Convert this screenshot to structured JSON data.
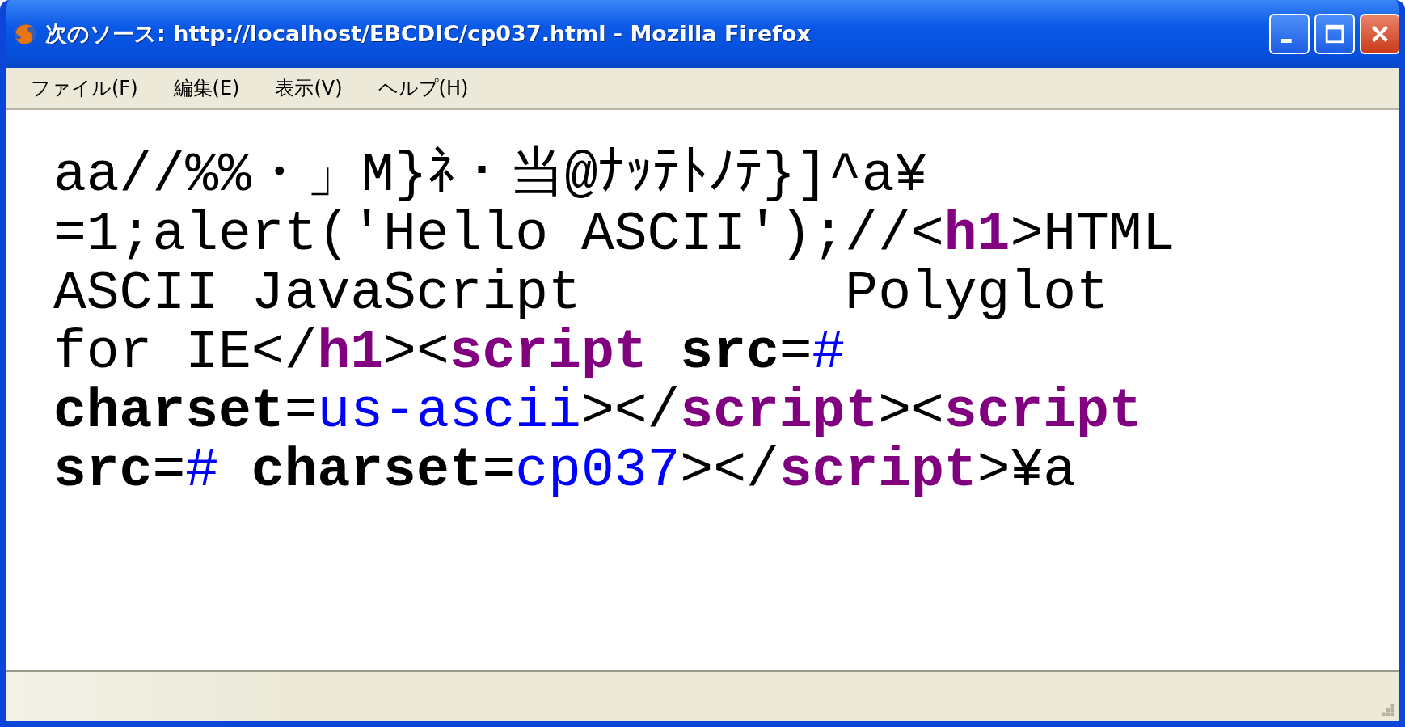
{
  "window": {
    "title": "次のソース: http://localhost/EBCDIC/cp037.html - Mozilla Firefox"
  },
  "menu": [
    "ファイル(F)",
    "編集(E)",
    "表示(V)",
    "ヘルプ(H)"
  ],
  "source_lines": [
    [
      {
        "kind": "plain",
        "text": "aa//%%・」M}ﾈ・当@ﾅｯﾃﾄﾉﾃ}]^a¥"
      }
    ],
    [
      {
        "kind": "plain",
        "text": "=1;alert('Hello ASCII');//<"
      },
      {
        "kind": "tag",
        "text": "h1"
      },
      {
        "kind": "plain",
        "text": ">HTML"
      }
    ],
    [
      {
        "kind": "plain",
        "text": "ASCII JavaScript        Polyglot"
      }
    ],
    [
      {
        "kind": "plain",
        "text": "for IE</"
      },
      {
        "kind": "tag",
        "text": "h1"
      },
      {
        "kind": "plain",
        "text": "><"
      },
      {
        "kind": "tag",
        "text": "script"
      },
      {
        "kind": "attr",
        "text": " src"
      },
      {
        "kind": "plain",
        "text": "="
      },
      {
        "kind": "value",
        "text": "#"
      }
    ],
    [
      {
        "kind": "attr",
        "text": "charset"
      },
      {
        "kind": "plain",
        "text": "="
      },
      {
        "kind": "value",
        "text": "us-ascii"
      },
      {
        "kind": "plain",
        "text": "></"
      },
      {
        "kind": "tag",
        "text": "script"
      },
      {
        "kind": "plain",
        "text": "><"
      },
      {
        "kind": "tag",
        "text": "script"
      }
    ],
    [
      {
        "kind": "attr",
        "text": "src"
      },
      {
        "kind": "plain",
        "text": "="
      },
      {
        "kind": "value",
        "text": "#"
      },
      {
        "kind": "attr",
        "text": " charset"
      },
      {
        "kind": "plain",
        "text": "="
      },
      {
        "kind": "value",
        "text": "cp037"
      },
      {
        "kind": "plain",
        "text": "></"
      },
      {
        "kind": "tag",
        "text": "script"
      },
      {
        "kind": "plain",
        "text": ">¥a"
      }
    ]
  ]
}
